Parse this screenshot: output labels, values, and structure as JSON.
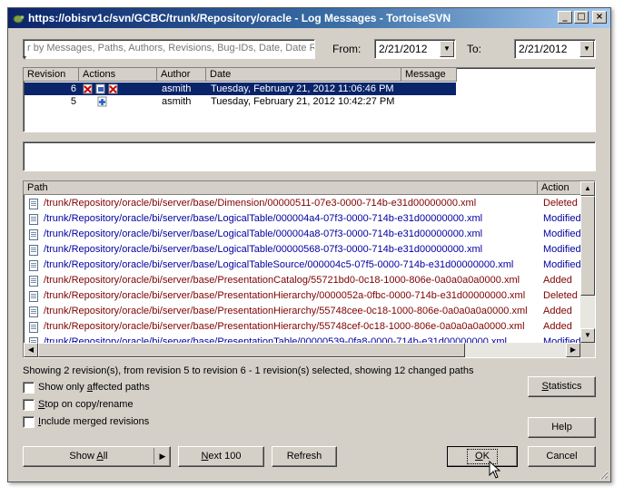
{
  "window": {
    "title": "https://obisrv1c/svn/GCBC/trunk/Repository/oracle - Log Messages - TortoiseSVN",
    "minimize": "_",
    "maximize": "□",
    "close": "×"
  },
  "filter": {
    "search_text": "r by Messages, Paths, Authors, Revisions, Bug-IDs, Date, Date R",
    "from_label": "From:",
    "from_value": "2/21/2012",
    "to_label": "To:",
    "to_value": "2/21/2012"
  },
  "revisions": {
    "headers": [
      "Revision",
      "Actions",
      "Author",
      "Date",
      "Message"
    ],
    "rows": [
      {
        "revision": "6",
        "author": "asmith",
        "date": "Tuesday, February 21, 2012 11:06:46 PM",
        "message": ""
      },
      {
        "revision": "5",
        "author": "asmith",
        "date": "Tuesday, February 21, 2012 10:42:27 PM",
        "message": ""
      }
    ]
  },
  "paths": {
    "headers": [
      "Path",
      "Action"
    ],
    "rows": [
      {
        "path": "/trunk/Repository/oracle/bi/server/base/Dimension/00000511-07e3-0000-714b-e31d00000000.xml",
        "action": "Deleted"
      },
      {
        "path": "/trunk/Repository/oracle/bi/server/base/LogicalTable/000004a4-07f3-0000-714b-e31d00000000.xml",
        "action": "Modified"
      },
      {
        "path": "/trunk/Repository/oracle/bi/server/base/LogicalTable/000004a8-07f3-0000-714b-e31d00000000.xml",
        "action": "Modified"
      },
      {
        "path": "/trunk/Repository/oracle/bi/server/base/LogicalTable/00000568-07f3-0000-714b-e31d00000000.xml",
        "action": "Modified"
      },
      {
        "path": "/trunk/Repository/oracle/bi/server/base/LogicalTableSource/000004c5-07f5-0000-714b-e31d00000000.xml",
        "action": "Modified"
      },
      {
        "path": "/trunk/Repository/oracle/bi/server/base/PresentationCatalog/55721bd0-0c18-1000-806e-0a0a0a0a0000.xml",
        "action": "Added"
      },
      {
        "path": "/trunk/Repository/oracle/bi/server/base/PresentationHierarchy/0000052a-0fbc-0000-714b-e31d00000000.xml",
        "action": "Deleted"
      },
      {
        "path": "/trunk/Repository/oracle/bi/server/base/PresentationHierarchy/55748cee-0c18-1000-806e-0a0a0a0a0000.xml",
        "action": "Added"
      },
      {
        "path": "/trunk/Repository/oracle/bi/server/base/PresentationHierarchy/55748cef-0c18-1000-806e-0a0a0a0a0000.xml",
        "action": "Added"
      },
      {
        "path": "/trunk/Repository/oracle/bi/server/base/PresentationTable/00000539-0fa8-0000-714b-e31d00000000.xml",
        "action": "Modified"
      }
    ]
  },
  "status_text": "Showing 2 revision(s), from revision 5 to revision 6 - 1 revision(s) selected, showing 12 changed paths",
  "options": {
    "affected_pre": "Show only ",
    "affected_key": "a",
    "affected_post": "ffected paths",
    "stop_key": "S",
    "stop_post": "top on copy/rename",
    "merged_pre": "I",
    "merged_post": "nclude merged revisions"
  },
  "buttons": {
    "statistics_key": "S",
    "statistics_post": "tatistics",
    "help": "Help",
    "show_all_pre": "Show ",
    "show_all_key": "A",
    "show_all_post": "ll",
    "next_key": "N",
    "next_post": "ext 100",
    "refresh": "Refresh",
    "ok_key": "O",
    "ok_post": "K",
    "cancel": "Cancel"
  },
  "colors": {
    "title_gradient_start": "#0a246a",
    "selection": "#0a246a",
    "path_blue": "#0000a0",
    "path_maroon": "#800000",
    "face": "#d4d0c8"
  }
}
